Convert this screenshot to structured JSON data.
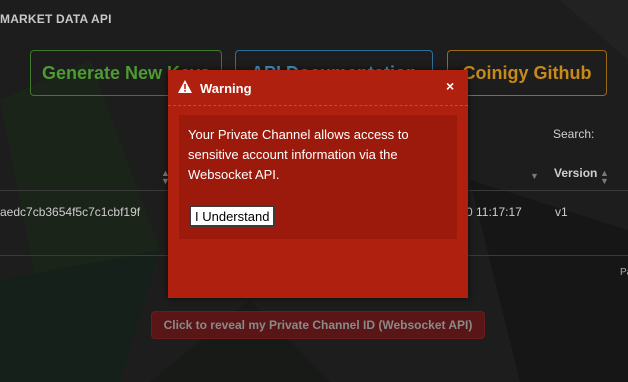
{
  "section": {
    "title": "MARKET DATA API"
  },
  "buttons": {
    "generate": "Generate New Keys",
    "docs": "API Documentation",
    "github": "Coinigy Github"
  },
  "search": {
    "label": "Search:"
  },
  "table": {
    "headers": {
      "version": "Version"
    },
    "row": {
      "key": "aedc7cb3654f5c7c1cbf19f",
      "date": "0 11:17:17",
      "version": "v1"
    }
  },
  "pagination": {
    "fragment": "Pa"
  },
  "reveal_button": "Click to reveal my Private Channel ID (Websocket API)",
  "modal": {
    "title": "Warning",
    "close": "×",
    "body": "Your Private Channel allows access to sensitive account information via the Websocket API.",
    "button": "I Understand"
  },
  "colors": {
    "modal_red": "#b0200e",
    "green": "#4e9a33",
    "blue": "#3f8fc2",
    "orange": "#c68a18"
  }
}
